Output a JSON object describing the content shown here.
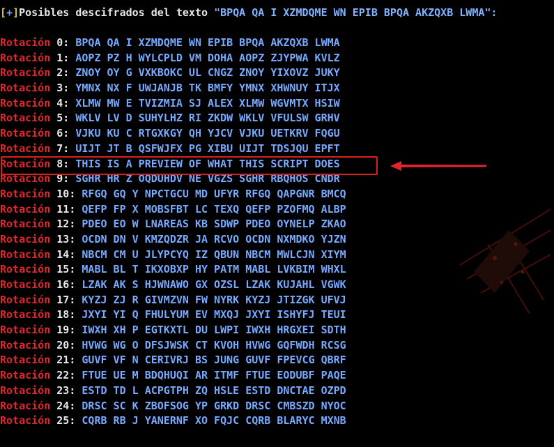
{
  "header": {
    "bracket_open": "[",
    "plus": "+",
    "bracket_close": "]",
    "prefix": "Posibles descifrados del texto ",
    "quoted": "\"BPQA QA I XZMDQME WN EPIB BPQA AKZQXB LWMA\":"
  },
  "rows": [
    {
      "label": "Rotación",
      "num": "0:",
      "text": "BPQA QA I XZMDQME WN EPIB BPQA AKZQXB LWMA"
    },
    {
      "label": "Rotación",
      "num": "1:",
      "text": "AOPZ PZ H WYLCPLD VM DOHA AOPZ ZJYPWA KVLZ"
    },
    {
      "label": "Rotación",
      "num": "2:",
      "text": "ZNOY OY G VXKBOKC UL CNGZ ZNOY YIXOVZ JUKY"
    },
    {
      "label": "Rotación",
      "num": "3:",
      "text": "YMNX NX F UWJANJB TK BMFY YMNX XHWNUY ITJX"
    },
    {
      "label": "Rotación",
      "num": "4:",
      "text": "XLMW MW E TVIZMIA SJ ALEX XLMW WGVMTX HSIW"
    },
    {
      "label": "Rotación",
      "num": "5:",
      "text": "WKLV LV D SUHYLHZ RI ZKDW WKLV VFULSW GRHV"
    },
    {
      "label": "Rotación",
      "num": "6:",
      "text": "VJKU KU C RTGXKGY QH YJCV VJKU UETKRV FQGU"
    },
    {
      "label": "Rotación",
      "num": "7:",
      "text": "UIJT JT B QSFWJFX PG XIBU UIJT TDSJQU EPFT"
    },
    {
      "label": "Rotación",
      "num": "8:",
      "text": "THIS IS A PREVIEW OF WHAT THIS SCRIPT DOES"
    },
    {
      "label": "Rotación",
      "num": "9:",
      "text": "SGHR HR Z OQDUHDV NE VGZS SGHR RBQHOS CNDR"
    },
    {
      "label": "Rotación",
      "num": "10:",
      "text": "RFGQ GQ Y NPCTGCU MD UFYR RFGQ QAPGNR BMCQ"
    },
    {
      "label": "Rotación",
      "num": "11:",
      "text": "QEFP FP X MOBSFBT LC TEXQ QEFP PZOFMQ ALBP"
    },
    {
      "label": "Rotación",
      "num": "12:",
      "text": "PDEO EO W LNAREAS KB SDWP PDEO OYNELP ZKAO"
    },
    {
      "label": "Rotación",
      "num": "13:",
      "text": "OCDN DN V KMZQDZR JA RCVO OCDN NXMDKO YJZN"
    },
    {
      "label": "Rotación",
      "num": "14:",
      "text": "NBCM CM U JLYPCYQ IZ QBUN NBCM MWLCJN XIYM"
    },
    {
      "label": "Rotación",
      "num": "15:",
      "text": "MABL BL T IKXOBXP HY PATM MABL LVKBIM WHXL"
    },
    {
      "label": "Rotación",
      "num": "16:",
      "text": "LZAK AK S HJWNAWO GX OZSL LZAK KUJAHL VGWK"
    },
    {
      "label": "Rotación",
      "num": "17:",
      "text": "KYZJ ZJ R GIVMZVN FW NYRK KYZJ JTIZGK UFVJ"
    },
    {
      "label": "Rotación",
      "num": "18:",
      "text": "JXYI YI Q FHULYUM EV MXQJ JXYI ISHYFJ TEUI"
    },
    {
      "label": "Rotación",
      "num": "19:",
      "text": "IWXH XH P EGTKXTL DU LWPI IWXH HRGXEI SDTH"
    },
    {
      "label": "Rotación",
      "num": "20:",
      "text": "HVWG WG O DFSJWSK CT KVOH HVWG GQFWDH RCSG"
    },
    {
      "label": "Rotación",
      "num": "21:",
      "text": "GUVF VF N CERIVRJ BS JUNG GUVF FPEVCG QBRF"
    },
    {
      "label": "Rotación",
      "num": "22:",
      "text": "FTUE UE M BDQHUQI AR ITMF FTUE EODUBF PAQE"
    },
    {
      "label": "Rotación",
      "num": "23:",
      "text": "ESTD TD L ACPGTPH ZQ HSLE ESTD DNCTAE OZPD"
    },
    {
      "label": "Rotación",
      "num": "24:",
      "text": "DRSC SC K ZBOFSOG YP GRKD DRSC CMBSZD NYOC"
    },
    {
      "label": "Rotación",
      "num": "25:",
      "text": "CQRB RB J YANERNF XO FQJC CQRB BLARYC MXNB"
    }
  ],
  "colors": {
    "background": "#000000",
    "label_red": "#e0262a",
    "text_blue": "#77a9ff",
    "highlight_red": "#d8201f"
  },
  "highlighted_row": 8
}
